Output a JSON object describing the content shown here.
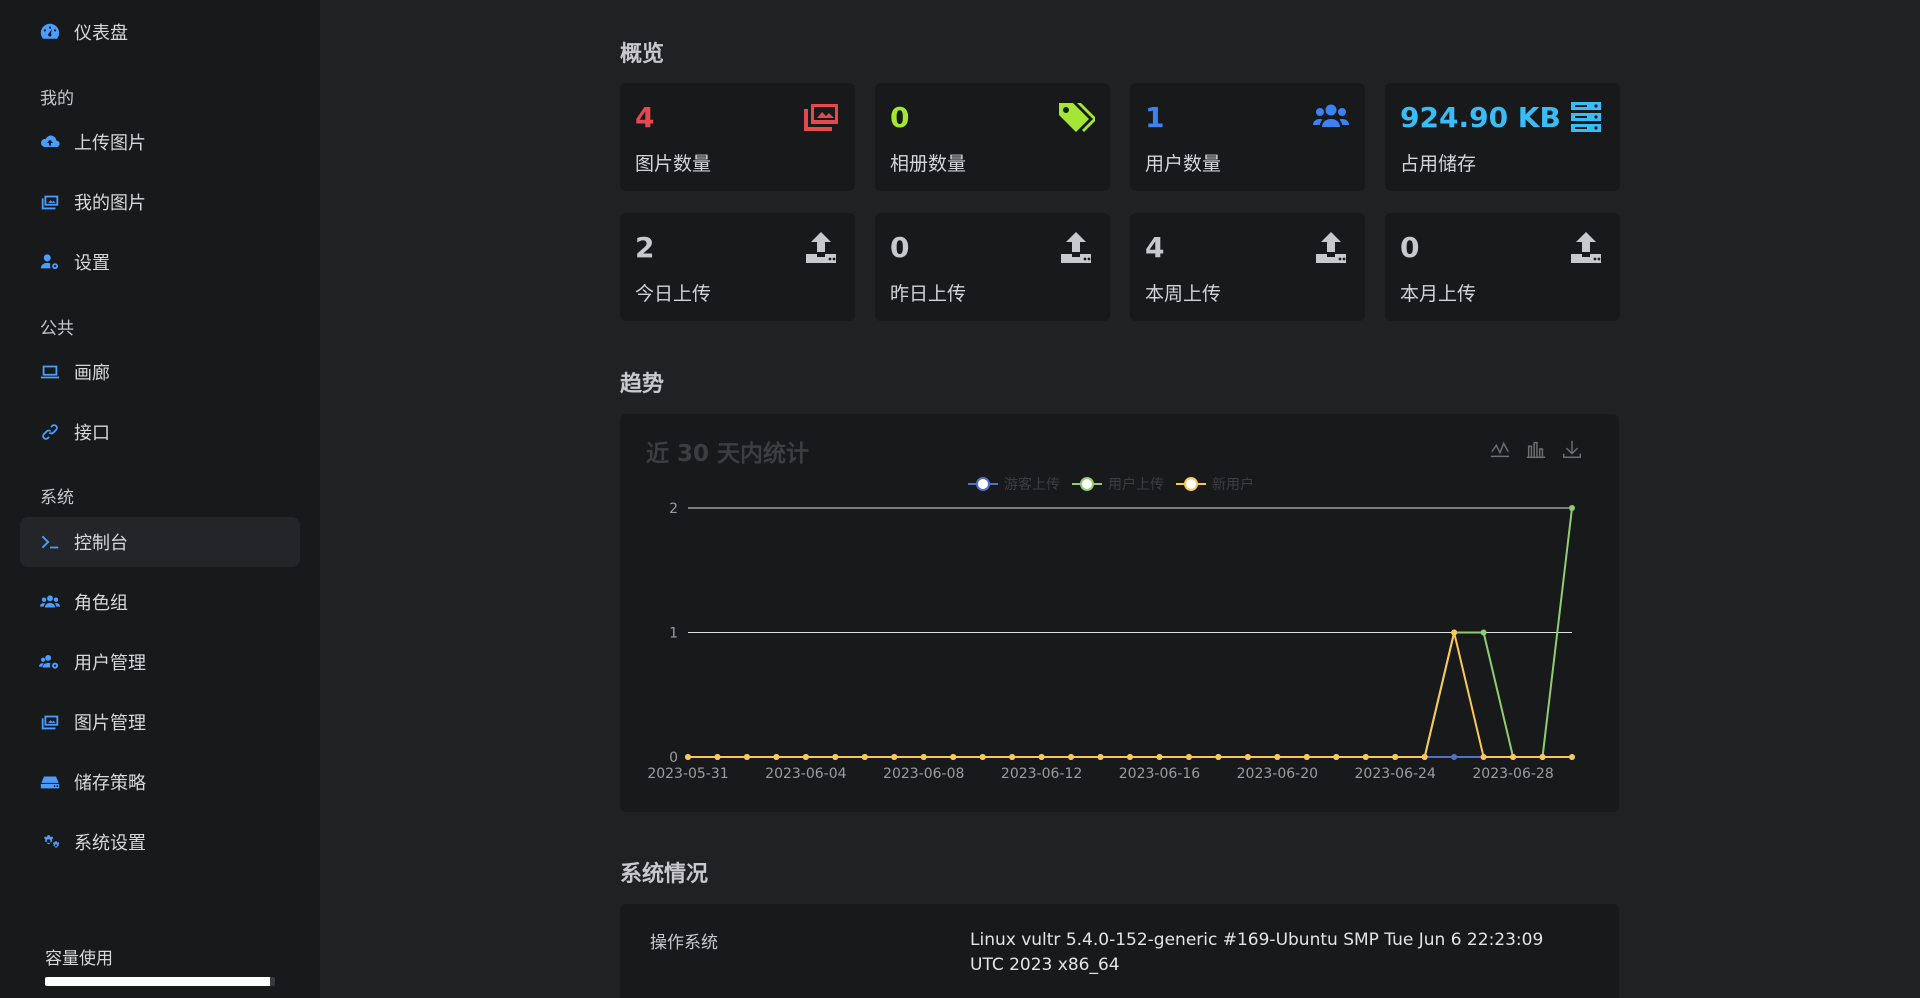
{
  "sidebar": {
    "dashboard": "仪表盘",
    "section_mine": "我的",
    "upload": "上传图片",
    "my_images": "我的图片",
    "settings": "设置",
    "section_public": "公共",
    "gallery": "画廊",
    "api": "接口",
    "section_system": "系统",
    "console": "控制台",
    "role_groups": "角色组",
    "user_mgmt": "用户管理",
    "image_mgmt": "图片管理",
    "storage_policy": "储存策略",
    "system_settings": "系统设置",
    "capacity_label": "容量使用",
    "capacity_fraction": 0.98
  },
  "overview": {
    "title": "概览",
    "cards": [
      {
        "value": "4",
        "label": "图片数量",
        "color": "#e5484d",
        "icon": "images-icon"
      },
      {
        "value": "0",
        "label": "相册数量",
        "color": "#a3e635",
        "icon": "tags-icon"
      },
      {
        "value": "1",
        "label": "用户数量",
        "color": "#3b82f6",
        "icon": "users-icon"
      },
      {
        "value": "924.90 KB",
        "label": "占用储存",
        "color": "#38bdf8",
        "icon": "server-icon"
      },
      {
        "value": "2",
        "label": "今日上传",
        "color": "#c9c9cd",
        "icon": "upload-icon"
      },
      {
        "value": "0",
        "label": "昨日上传",
        "color": "#c9c9cd",
        "icon": "upload-icon"
      },
      {
        "value": "4",
        "label": "本周上传",
        "color": "#c9c9cd",
        "icon": "upload-icon"
      },
      {
        "value": "0",
        "label": "本月上传",
        "color": "#c9c9cd",
        "icon": "upload-icon"
      }
    ]
  },
  "trend": {
    "title": "趋势"
  },
  "chart_data": {
    "type": "line",
    "title": "近 30 天内统计",
    "x": [
      "2023-05-31",
      "2023-06-01",
      "2023-06-02",
      "2023-06-03",
      "2023-06-04",
      "2023-06-05",
      "2023-06-06",
      "2023-06-07",
      "2023-06-08",
      "2023-06-09",
      "2023-06-10",
      "2023-06-11",
      "2023-06-12",
      "2023-06-13",
      "2023-06-14",
      "2023-06-15",
      "2023-06-16",
      "2023-06-17",
      "2023-06-18",
      "2023-06-19",
      "2023-06-20",
      "2023-06-21",
      "2023-06-22",
      "2023-06-23",
      "2023-06-24",
      "2023-06-25",
      "2023-06-26",
      "2023-06-27",
      "2023-06-28",
      "2023-06-29",
      "2023-06-30"
    ],
    "x_ticks": [
      "2023-05-31",
      "2023-06-04",
      "2023-06-08",
      "2023-06-12",
      "2023-06-16",
      "2023-06-20",
      "2023-06-24",
      "2023-06-28"
    ],
    "y_ticks": [
      0,
      1,
      2
    ],
    "ylim": [
      0,
      2
    ],
    "grid": true,
    "legend": "top-center",
    "series": [
      {
        "name": "游客上传",
        "color": "#5470c6",
        "values": [
          0,
          0,
          0,
          0,
          0,
          0,
          0,
          0,
          0,
          0,
          0,
          0,
          0,
          0,
          0,
          0,
          0,
          0,
          0,
          0,
          0,
          0,
          0,
          0,
          0,
          0,
          0,
          0,
          0,
          0,
          0
        ]
      },
      {
        "name": "用户上传",
        "color": "#91cc75",
        "values": [
          0,
          0,
          0,
          0,
          0,
          0,
          0,
          0,
          0,
          0,
          0,
          0,
          0,
          0,
          0,
          0,
          0,
          0,
          0,
          0,
          0,
          0,
          0,
          0,
          0,
          0,
          1,
          1,
          0,
          0,
          2
        ]
      },
      {
        "name": "新用户",
        "color": "#fac858",
        "values": [
          0,
          0,
          0,
          0,
          0,
          0,
          0,
          0,
          0,
          0,
          0,
          0,
          0,
          0,
          0,
          0,
          0,
          0,
          0,
          0,
          0,
          0,
          0,
          0,
          0,
          0,
          1,
          0,
          0,
          0,
          0
        ]
      }
    ]
  },
  "system": {
    "title": "系统情况",
    "os_key": "操作系统",
    "os_value": "Linux vultr 5.4.0-152-generic #169-Ubuntu SMP Tue Jun 6 22:23:09 UTC 2023 x86_64"
  }
}
